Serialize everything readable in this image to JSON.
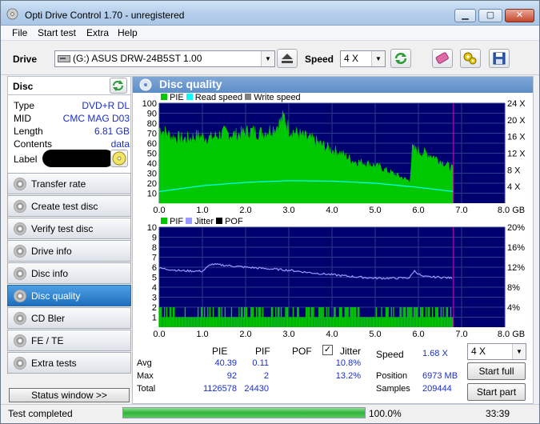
{
  "window": {
    "title": "Opti Drive Control 1.70 - unregistered",
    "caption_buttons": [
      "minimize",
      "maximize",
      "close"
    ]
  },
  "menu": {
    "items": [
      "File",
      "Start test",
      "Extra",
      "Help"
    ]
  },
  "toolbar": {
    "drive_label": "Drive",
    "drive_value": "(G:)  ASUS DRW-24B5ST 1.00",
    "speed_label": "Speed",
    "speed_value": "4 X",
    "icons": [
      "eject-icon",
      "refresh-icon",
      "erase-icon",
      "settings-icon",
      "save-icon"
    ]
  },
  "disc": {
    "header": "Disc",
    "rows": [
      {
        "key": "Type",
        "value": "DVD+R DL"
      },
      {
        "key": "MID",
        "value": "CMC MAG D03"
      },
      {
        "key": "Length",
        "value": "6.81 GB"
      },
      {
        "key": "Contents",
        "value": "data"
      },
      {
        "key": "Label",
        "value": ""
      }
    ]
  },
  "nav": {
    "items": [
      {
        "label": "Transfer rate",
        "active": false
      },
      {
        "label": "Create test disc",
        "active": false
      },
      {
        "label": "Verify test disc",
        "active": false
      },
      {
        "label": "Drive info",
        "active": false
      },
      {
        "label": "Disc info",
        "active": false
      },
      {
        "label": "Disc quality",
        "active": true
      },
      {
        "label": "CD Bler",
        "active": false
      },
      {
        "label": "FE / TE",
        "active": false
      },
      {
        "label": "Extra tests",
        "active": false
      }
    ],
    "status_button": "Status window >>"
  },
  "panel": {
    "title": "Disc quality"
  },
  "chart_data": [
    {
      "type": "area",
      "legend": [
        "PIE",
        "Read speed",
        "Write speed"
      ],
      "colors": {
        "PIE": "#00c800",
        "Read speed": "#00ffff",
        "Write speed": "#808080",
        "background": "#00006e",
        "grid": "#2b3c8e",
        "marker": "#c000c0"
      },
      "x_ticks": [
        "0.0",
        "1.0",
        "2.0",
        "3.0",
        "4.0",
        "5.0",
        "6.0",
        "7.0",
        "8.0 GB"
      ],
      "y_ticks_left": [
        "100",
        "90",
        "80",
        "70",
        "60",
        "50",
        "40",
        "30",
        "20",
        "10"
      ],
      "y_ticks_right": [
        "24 X",
        "20 X",
        "16 X",
        "12 X",
        "8 X",
        "4 X"
      ],
      "xlim": [
        0,
        8
      ],
      "ylim": [
        0,
        100
      ],
      "y2lim": [
        0,
        24
      ],
      "series": [
        {
          "name": "PIE",
          "x": [
            0.0,
            0.3,
            0.6,
            0.9,
            1.2,
            1.5,
            1.8,
            2.1,
            2.4,
            2.7,
            2.9,
            3.0,
            3.3,
            3.6,
            3.9,
            4.2,
            4.5,
            4.8,
            5.1,
            5.4,
            5.7,
            5.8,
            5.86,
            6.0,
            6.3,
            6.6,
            6.81
          ],
          "y": [
            75,
            66,
            64,
            67,
            65,
            70,
            68,
            72,
            70,
            76,
            86,
            74,
            67,
            62,
            55,
            50,
            42,
            40,
            36,
            30,
            24,
            22,
            54,
            52,
            48,
            40,
            34
          ]
        },
        {
          "name": "Read speed",
          "x": [
            0.0,
            1.0,
            2.0,
            3.0,
            4.0,
            5.0,
            6.0,
            6.81
          ],
          "y": [
            2.8,
            4.2,
            5.0,
            5.4,
            5.3,
            4.8,
            3.8,
            2.8
          ]
        }
      ],
      "end_marker": 6.81
    },
    {
      "type": "bar",
      "legend": [
        "PIF",
        "Jitter",
        "POF"
      ],
      "colors": {
        "PIF": "#00c800",
        "Jitter": "#9999ff",
        "POF": "#000000",
        "background": "#00006e",
        "grid": "#2b3c8e",
        "marker": "#c000c0"
      },
      "x_ticks": [
        "0.0",
        "1.0",
        "2.0",
        "3.0",
        "4.0",
        "5.0",
        "6.0",
        "7.0",
        "8.0 GB"
      ],
      "y_ticks_left": [
        "10",
        "9",
        "8",
        "7",
        "6",
        "5",
        "4",
        "3",
        "2",
        "1"
      ],
      "y_ticks_right": [
        "20%",
        "16%",
        "12%",
        "8%",
        "4%"
      ],
      "xlim": [
        0,
        8
      ],
      "ylim": [
        0,
        10
      ],
      "y2lim": [
        0,
        20
      ],
      "series": [
        {
          "name": "Jitter",
          "x": [
            0.0,
            0.5,
            1.0,
            1.2,
            1.5,
            2.0,
            2.5,
            3.0,
            3.5,
            4.0,
            4.5,
            5.0,
            5.5,
            5.8,
            5.9,
            6.1,
            6.5,
            6.81
          ],
          "y": [
            11.8,
            11.3,
            11.2,
            12.6,
            12.4,
            12.0,
            11.7,
            11.4,
            10.9,
            10.5,
            10.1,
            9.8,
            9.8,
            9.9,
            11.3,
            10.1,
            10.0,
            9.8
          ]
        },
        {
          "name": "PIF",
          "x_range": [
            0.0,
            6.81
          ],
          "typical": 1,
          "max": 2
        }
      ],
      "end_marker": 6.81
    }
  ],
  "stats": {
    "columns": [
      "PIE",
      "PIF",
      "POF",
      "Jitter"
    ],
    "jitter_checked": true,
    "rows": [
      {
        "label": "Avg",
        "pie": "40.39",
        "pif": "0.11",
        "pof": "",
        "jitter": "10.8%"
      },
      {
        "label": "Max",
        "pie": "92",
        "pif": "2",
        "pof": "",
        "jitter": "13.2%"
      },
      {
        "label": "Total",
        "pie": "1126578",
        "pif": "24430",
        "pof": "",
        "jitter": ""
      }
    ],
    "speed_label": "Speed",
    "speed_value": "1.68 X",
    "position_label": "Position",
    "position_value": "6973 MB",
    "samples_label": "Samples",
    "samples_value": "209444",
    "speed_select": "4 X",
    "start_full": "Start full",
    "start_part": "Start part"
  },
  "status": {
    "text": "Test completed",
    "progress": 1.0,
    "progress_text": "100.0%",
    "time": "33:39"
  }
}
